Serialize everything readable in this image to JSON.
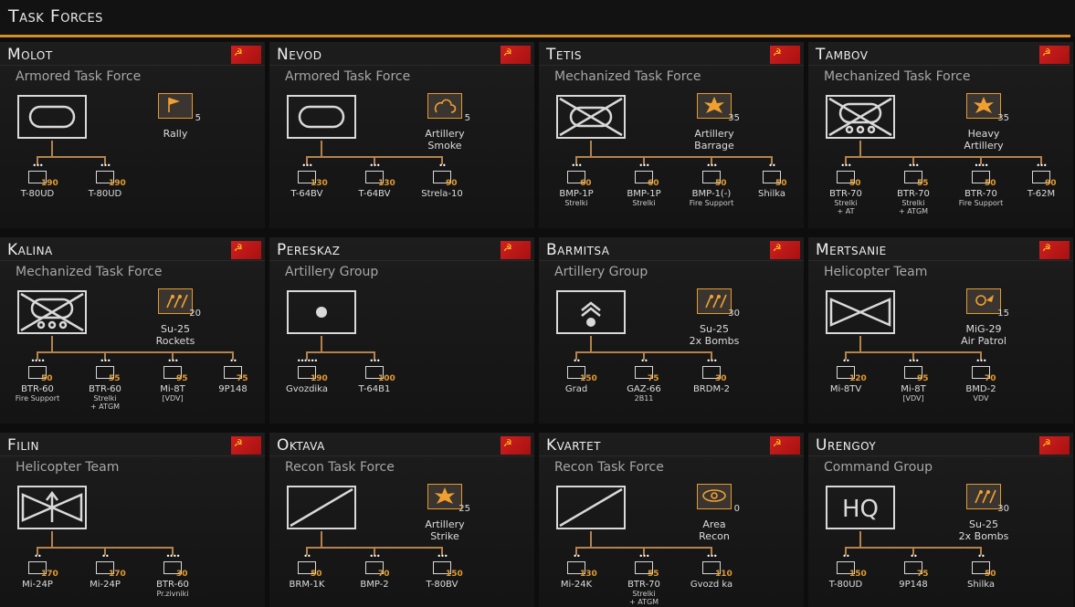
{
  "header": {
    "title": "Task Forces"
  },
  "cards": [
    {
      "name": "Molot",
      "type": "Armored Task Force",
      "hq": "armor",
      "support": {
        "icon": "rally-flag-icon",
        "count": "5",
        "name": "Rally",
        "name2": ""
      },
      "units": [
        {
          "name": "T-80UD",
          "sub": "",
          "cost": "190",
          "dots": "•••"
        },
        {
          "name": "T-80UD",
          "sub": "",
          "cost": "190",
          "dots": "•••"
        }
      ]
    },
    {
      "name": "Nevod",
      "type": "Armored Task Force",
      "hq": "armor",
      "support": {
        "icon": "smoke-icon",
        "count": "5",
        "name": "Artillery",
        "name2": "Smoke"
      },
      "units": [
        {
          "name": "T-64BV",
          "sub": "",
          "cost": "130",
          "dots": "•••"
        },
        {
          "name": "T-64BV",
          "sub": "",
          "cost": "130",
          "dots": "•••"
        },
        {
          "name": "Strela-10",
          "sub": "",
          "cost": "90",
          "dots": "••"
        }
      ]
    },
    {
      "name": "Tetis",
      "type": "Mechanized Task Force",
      "hq": "mech",
      "support": {
        "icon": "barrage-icon",
        "count": "35",
        "name": "Artillery",
        "name2": "Barrage"
      },
      "units": [
        {
          "name": "BMP-1P",
          "sub": "Strelki",
          "cost": "60",
          "dots": "•••"
        },
        {
          "name": "BMP-1P",
          "sub": "Strelki",
          "cost": "60",
          "dots": "•••"
        },
        {
          "name": "BMP-1(-)",
          "sub": "Fire Support",
          "cost": "50",
          "dots": "•••"
        },
        {
          "name": "Shilka",
          "sub": "",
          "cost": "50",
          "dots": "••"
        }
      ]
    },
    {
      "name": "Tambov",
      "type": "Mechanized Task Force",
      "hq": "mech-wheel",
      "support": {
        "icon": "heavy-artillery-icon",
        "count": "35",
        "name": "Heavy",
        "name2": "Artillery"
      },
      "units": [
        {
          "name": "BTR-70",
          "sub": "Strelki",
          "sub2": "+ AT",
          "cost": "50",
          "dots": "•••"
        },
        {
          "name": "BTR-70",
          "sub": "Strelki",
          "sub2": "+ ATGM",
          "cost": "55",
          "dots": "•••"
        },
        {
          "name": "BTR-70",
          "sub": "Fire Support",
          "cost": "50",
          "dots": "••••"
        },
        {
          "name": "T-62M",
          "sub": "",
          "cost": "90",
          "dots": "•••"
        }
      ]
    },
    {
      "name": "Kalina",
      "type": "Mechanized Task Force",
      "hq": "mech-wheel",
      "support": {
        "icon": "rockets-icon",
        "count": "20",
        "name": "Su-25",
        "name2": "Rockets"
      },
      "units": [
        {
          "name": "BTR-60",
          "sub": "Fire Support",
          "cost": "50",
          "dots": "••••"
        },
        {
          "name": "BTR-60",
          "sub": "Strelki",
          "sub2": "+ ATGM",
          "cost": "55",
          "dots": "•••"
        },
        {
          "name": "Mi-8T",
          "sub": "[VDV]",
          "cost": "95",
          "dots": "•••"
        },
        {
          "name": "9P148",
          "sub": "",
          "cost": "75",
          "dots": "••"
        }
      ]
    },
    {
      "name": "Pereskaz",
      "type": "Artillery Group",
      "hq": "artillery",
      "support": null,
      "units": [
        {
          "name": "Gvozdika",
          "sub": "",
          "cost": "190",
          "dots": "••••••"
        },
        {
          "name": "T-64B1",
          "sub": "",
          "cost": "100",
          "dots": "•••"
        }
      ]
    },
    {
      "name": "Barmitsa",
      "type": "Artillery Group",
      "hq": "rocket",
      "support": {
        "icon": "bombs-icon",
        "count": "30",
        "name": "Su-25",
        "name2": "2x Bombs"
      },
      "units": [
        {
          "name": "Grad",
          "sub": "",
          "cost": "150",
          "dots": "••"
        },
        {
          "name": "GAZ-66",
          "sub": "2B11",
          "cost": "75",
          "dots": "••"
        },
        {
          "name": "BRDM-2",
          "sub": "",
          "cost": "30",
          "dots": "•••"
        }
      ]
    },
    {
      "name": "Mertsanie",
      "type": "Helicopter Team",
      "hq": "heli",
      "support": {
        "icon": "air-patrol-icon",
        "count": "15",
        "name": "MiG-29",
        "name2": "Air Patrol"
      },
      "units": [
        {
          "name": "Mi-8TV",
          "sub": "",
          "cost": "120",
          "dots": "••"
        },
        {
          "name": "Mi-8T",
          "sub": "[VDV]",
          "cost": "95",
          "dots": "•••"
        },
        {
          "name": "BMD-2",
          "sub": "VDV",
          "cost": "70",
          "dots": "•••"
        }
      ]
    },
    {
      "name": "Filin",
      "type": "Helicopter Team",
      "hq": "heli-at",
      "support": null,
      "units": [
        {
          "name": "Mi-24P",
          "sub": "",
          "cost": "170",
          "dots": "••"
        },
        {
          "name": "Mi-24P",
          "sub": "",
          "cost": "170",
          "dots": "••"
        },
        {
          "name": "BTR-60",
          "sub": "Pr.zivniki",
          "cost": "30",
          "dots": "••••"
        }
      ]
    },
    {
      "name": "Oktava",
      "type": "Recon Task Force",
      "hq": "recon",
      "support": {
        "icon": "strike-icon",
        "count": "25",
        "name": "Artillery",
        "name2": "Strike"
      },
      "units": [
        {
          "name": "BRM-1K",
          "sub": "",
          "cost": "50",
          "dots": "••"
        },
        {
          "name": "BMP-2",
          "sub": "",
          "cost": "70",
          "dots": "•••"
        },
        {
          "name": "T-80BV",
          "sub": "",
          "cost": "150",
          "dots": "•••"
        }
      ]
    },
    {
      "name": "Kvartet",
      "type": "Recon Task Force",
      "hq": "recon",
      "support": {
        "icon": "eye-icon",
        "count": "0",
        "name": "Area",
        "name2": "Recon"
      },
      "units": [
        {
          "name": "Mi-24K",
          "sub": "",
          "cost": "130",
          "dots": "••"
        },
        {
          "name": "BTR-70",
          "sub": "Strelki",
          "sub2": "+ ATGM",
          "cost": "55",
          "dots": "•••"
        },
        {
          "name": "Gvozd ka",
          "sub": "",
          "cost": "110",
          "dots": "•••"
        }
      ]
    },
    {
      "name": "Urengoy",
      "type": "Command Group",
      "hq": "hq",
      "support": {
        "icon": "bombs-icon",
        "count": "30",
        "name": "Su-25",
        "name2": "2x Bombs"
      },
      "units": [
        {
          "name": "T-80UD",
          "sub": "",
          "cost": "150",
          "dots": "••"
        },
        {
          "name": "9P148",
          "sub": "",
          "cost": "75",
          "dots": "••"
        },
        {
          "name": "Shilka",
          "sub": "",
          "cost": "50",
          "dots": "••"
        }
      ]
    }
  ],
  "hq_text": "HQ"
}
